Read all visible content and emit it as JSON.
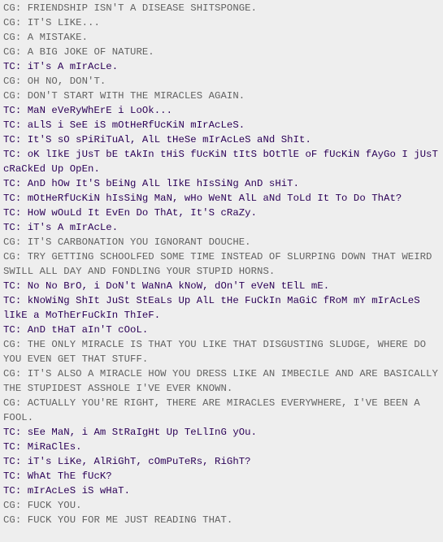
{
  "colors": {
    "background": "#eeeeee",
    "cg": "#626262",
    "tc": "#2b0057"
  },
  "log": [
    {
      "speaker": "CG",
      "text": "CG: FRIENDSHIP ISN'T A DISEASE SHITSPONGE."
    },
    {
      "speaker": "CG",
      "text": "CG: IT'S LIKE..."
    },
    {
      "speaker": "CG",
      "text": "CG: A MISTAKE."
    },
    {
      "speaker": "CG",
      "text": "CG: A BIG JOKE OF NATURE."
    },
    {
      "speaker": "TC",
      "text": "TC: iT's A mIrAcLe."
    },
    {
      "speaker": "CG",
      "text": "CG: OH NO, DON'T."
    },
    {
      "speaker": "CG",
      "text": "CG: DON'T START WITH THE MIRACLES AGAIN."
    },
    {
      "speaker": "TC",
      "text": "TC: MaN eVeRyWhErE i LoOk..."
    },
    {
      "speaker": "TC",
      "text": "TC: aLlS i SeE iS mOtHeRfUcKiN mIrAcLeS."
    },
    {
      "speaker": "TC",
      "text": "TC: It'S sO sPiRiTuAl, AlL tHeSe mIrAcLeS aNd ShIt."
    },
    {
      "speaker": "TC",
      "text": "TC: oK lIkE jUsT bE tAkIn tHiS fUcKiN tItS bOtTlE oF fUcKiN fAyGo I jUsT cRaCkEd Up OpEn."
    },
    {
      "speaker": "TC",
      "text": "TC: AnD hOw It'S bEiNg AlL lIkE hIsSiNg AnD sHiT."
    },
    {
      "speaker": "TC",
      "text": "TC: mOtHeRfUcKiN hIsSiNg MaN, wHo WeNt AlL aNd ToLd It To Do ThAt?"
    },
    {
      "speaker": "TC",
      "text": "TC: HoW wOuLd It EvEn Do ThAt, It'S cRaZy."
    },
    {
      "speaker": "TC",
      "text": "TC: iT's A mIrAcLe."
    },
    {
      "speaker": "CG",
      "text": "CG: IT'S CARBONATION YOU IGNORANT DOUCHE."
    },
    {
      "speaker": "CG",
      "text": "CG: TRY GETTING SCHOOLFED SOME TIME INSTEAD OF SLURPING DOWN THAT WEIRD SWILL ALL DAY AND FONDLING YOUR STUPID HORNS."
    },
    {
      "speaker": "TC",
      "text": "TC: No No BrO, i DoN't WaNnA kNoW, dOn'T eVeN tElL mE."
    },
    {
      "speaker": "TC",
      "text": "TC: kNoWiNg ShIt JuSt StEaLs Up AlL tHe FuCkIn MaGiC fRoM mY mIrAcLeS lIkE a MoThErFuCkIn ThIeF."
    },
    {
      "speaker": "TC",
      "text": "TC: AnD tHaT aIn'T cOoL."
    },
    {
      "speaker": "CG",
      "text": "CG: THE ONLY MIRACLE IS THAT YOU LIKE THAT DISGUSTING SLUDGE, WHERE DO YOU EVEN GET THAT STUFF."
    },
    {
      "speaker": "CG",
      "text": "CG: IT'S ALSO A MIRACLE HOW YOU DRESS LIKE AN IMBECILE AND ARE BASICALLY THE STUPIDEST ASSHOLE I'VE EVER KNOWN."
    },
    {
      "speaker": "CG",
      "text": "CG: ACTUALLY YOU'RE RIGHT, THERE ARE MIRACLES EVERYWHERE, I'VE BEEN A FOOL."
    },
    {
      "speaker": "TC",
      "text": "TC: sEe MaN, i Am StRaIgHt Up TeLlInG yOu."
    },
    {
      "speaker": "TC",
      "text": "TC: MiRaClEs."
    },
    {
      "speaker": "TC",
      "text": "TC: iT's LiKe, AlRiGhT, cOmPuTeRs, RiGhT?"
    },
    {
      "speaker": "TC",
      "text": "TC: WhAt ThE fUcK?"
    },
    {
      "speaker": "TC",
      "text": "TC: mIrAcLeS iS wHaT."
    },
    {
      "speaker": "CG",
      "text": "CG: FUCK YOU."
    },
    {
      "speaker": "CG",
      "text": "CG: FUCK YOU FOR ME JUST READING THAT."
    }
  ]
}
